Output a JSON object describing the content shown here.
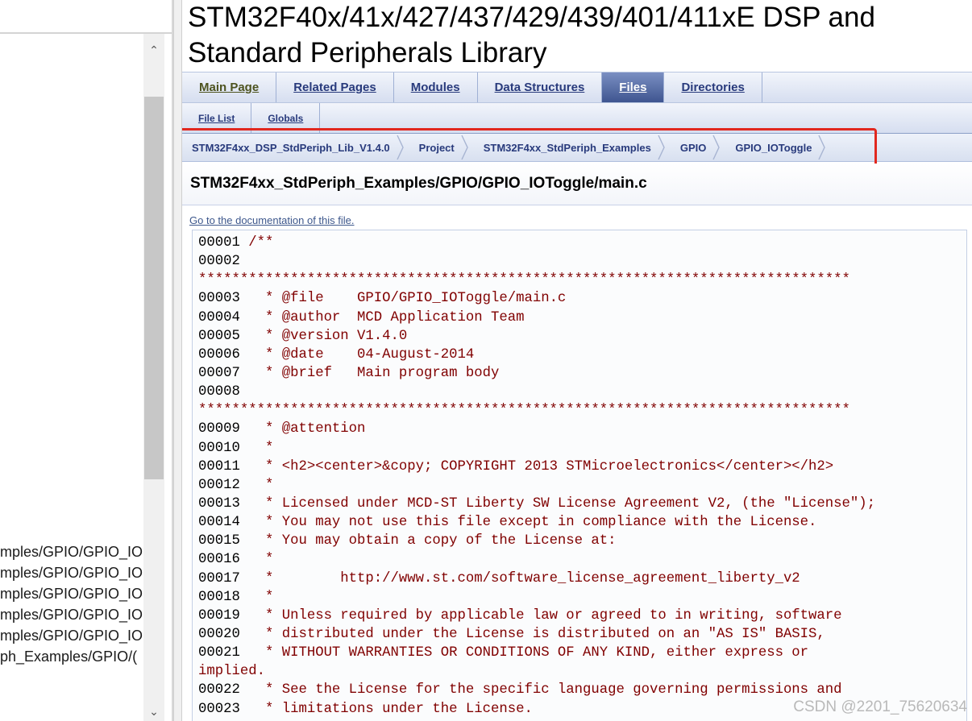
{
  "left_panel": {
    "scroll_up_icon": "chevron-up-icon",
    "scroll_down_icon": "chevron-down-icon",
    "items": [
      "mples/GPIO/GPIO_IO",
      "mples/GPIO/GPIO_IO",
      "mples/GPIO/GPIO_IO",
      "mples/GPIO/GPIO_IO",
      "mples/GPIO/GPIO_IO",
      "ph_Examples/GPIO/("
    ]
  },
  "doc": {
    "title": "STM32F40x/41x/427/437/429/439/401/411xE DSP and Standard Peripherals Library",
    "tabs": [
      {
        "label": "Main Page",
        "selected": false
      },
      {
        "label": "Related Pages",
        "selected": false
      },
      {
        "label": "Modules",
        "selected": false
      },
      {
        "label": "Data Structures",
        "selected": false
      },
      {
        "label": "Files",
        "selected": true
      },
      {
        "label": "Directories",
        "selected": false
      }
    ],
    "subtabs": [
      {
        "label": "File List"
      },
      {
        "label": "Globals"
      }
    ],
    "breadcrumb": [
      "STM32F4xx_DSP_StdPeriph_Lib_V1.4.0",
      "Project",
      "STM32F4xx_StdPeriph_Examples",
      "GPIO",
      "GPIO_IOToggle"
    ],
    "file_path": "STM32F4xx_StdPeriph_Examples/GPIO/GPIO_IOToggle/main.c",
    "doc_link": "Go to the documentation of this file.",
    "code_lines": [
      {
        "num": "00001",
        "text": " /**"
      },
      {
        "num": "00002",
        "text": ""
      },
      {
        "num": "",
        "text": "******************************************************************************"
      },
      {
        "num": "00003",
        "text": "   * @file    GPIO/GPIO_IOToggle/main.c"
      },
      {
        "num": "00004",
        "text": "   * @author  MCD Application Team"
      },
      {
        "num": "00005",
        "text": "   * @version V1.4.0"
      },
      {
        "num": "00006",
        "text": "   * @date    04-August-2014"
      },
      {
        "num": "00007",
        "text": "   * @brief   Main program body"
      },
      {
        "num": "00008",
        "text": ""
      },
      {
        "num": "",
        "text": "******************************************************************************"
      },
      {
        "num": "00009",
        "text": "   * @attention"
      },
      {
        "num": "00010",
        "text": "   *"
      },
      {
        "num": "00011",
        "text": "   * <h2><center>&copy; COPYRIGHT 2013 STMicroelectronics</center></h2>"
      },
      {
        "num": "00012",
        "text": "   *"
      },
      {
        "num": "00013",
        "text": "   * Licensed under MCD-ST Liberty SW License Agreement V2, (the \"License\");"
      },
      {
        "num": "00014",
        "text": "   * You may not use this file except in compliance with the License."
      },
      {
        "num": "00015",
        "text": "   * You may obtain a copy of the License at:"
      },
      {
        "num": "00016",
        "text": "   *"
      },
      {
        "num": "00017",
        "text": "   *        http://www.st.com/software_license_agreement_liberty_v2"
      },
      {
        "num": "00018",
        "text": "   *"
      },
      {
        "num": "00019",
        "text": "   * Unless required by applicable law or agreed to in writing, software"
      },
      {
        "num": "00020",
        "text": "   * distributed under the License is distributed on an \"AS IS\" BASIS,"
      },
      {
        "num": "00021",
        "text": "   * WITHOUT WARRANTIES OR CONDITIONS OF ANY KIND, either express or"
      },
      {
        "num": "",
        "text": "implied."
      },
      {
        "num": "00022",
        "text": "   * See the License for the specific language governing permissions and"
      },
      {
        "num": "00023",
        "text": "   * limitations under the License."
      }
    ]
  },
  "watermark": "CSDN @2201_75620634",
  "colors": {
    "code_text": "#800000",
    "link": "#283a7c",
    "tab_selected_bg": "#3f5590",
    "highlight_box": "#e1281f"
  }
}
